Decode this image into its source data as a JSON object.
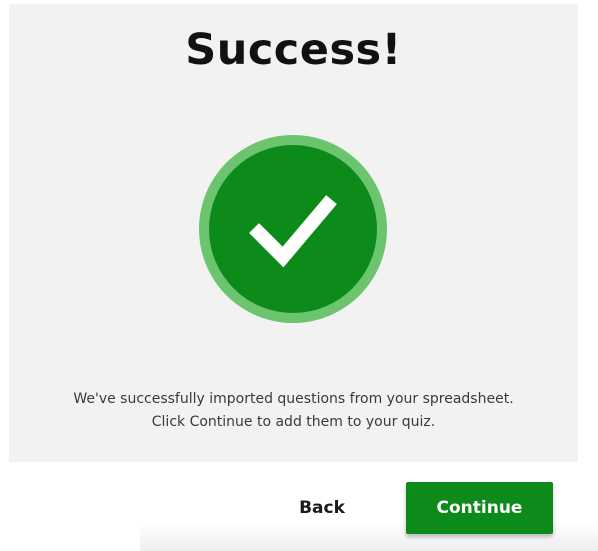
{
  "dialog": {
    "title": "Success!",
    "icon": "checkmark-circle-icon",
    "message_line1": "We've successfully imported questions from your spreadsheet.",
    "message_line2": "Click Continue to add them to your quiz."
  },
  "footer": {
    "back_label": "Back",
    "continue_label": "Continue"
  },
  "colors": {
    "panel_background": "#f2f2f2",
    "success_green": "#0c8a1a",
    "success_ring": "#6cc46f",
    "button_text": "#ffffff"
  }
}
